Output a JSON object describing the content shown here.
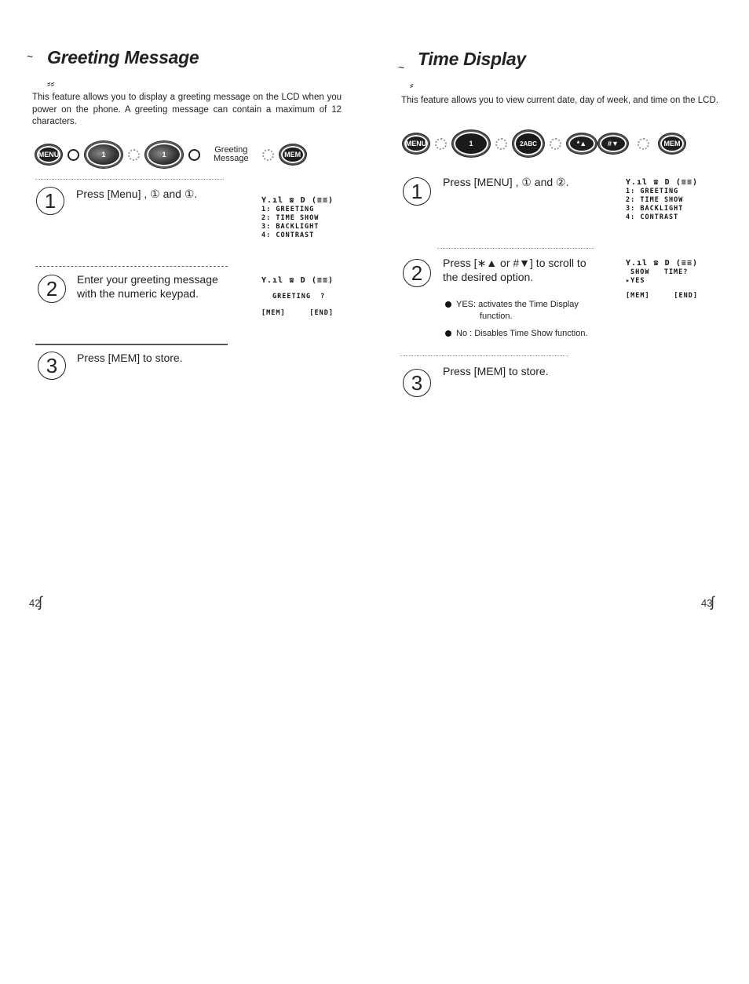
{
  "left_page": {
    "title": "Greeting Message",
    "intro": "This feature allows you to display a greeting message on the LCD when you power on the phone. A greeting message can contain a maximum of 12 characters.",
    "key_sequence": [
      {
        "type": "key",
        "label": "MENU",
        "icon": "menu-key-icon"
      },
      {
        "type": "arrow"
      },
      {
        "type": "key",
        "label": "1",
        "icon": "one-key-icon"
      },
      {
        "type": "arrow"
      },
      {
        "type": "key",
        "label": "1",
        "icon": "one-key-icon"
      },
      {
        "type": "arrow"
      },
      {
        "type": "label",
        "label": "Greeting Message"
      },
      {
        "type": "arrow"
      },
      {
        "type": "key",
        "label": "MEM",
        "icon": "mem-key-icon"
      }
    ],
    "key_labels": {
      "menu": "MENU",
      "one": "1",
      "mem": "MEM",
      "greeting_line1": "Greeting",
      "greeting_line2": "Message"
    },
    "steps": [
      {
        "number": "1",
        "text": "Press [Menu] , ① and ①."
      },
      {
        "number": "2",
        "text": "Enter your greeting message with the numeric keypad."
      },
      {
        "number": "3",
        "text": "Press [MEM] to store."
      }
    ],
    "lcd1": {
      "icons": {
        "signal": "signal-icon",
        "phone": "phone-icon",
        "d": "D",
        "battery": "battery-icon"
      },
      "lines": [
        "1: GREETING",
        "2: TIME SHOW",
        "3: BACKLIGHT",
        "4: CONTRAST"
      ]
    },
    "lcd2": {
      "line": "GREETING  ?",
      "soft_left": "[MEM]",
      "soft_right": "[END]"
    },
    "page_number": "42"
  },
  "right_page": {
    "title": "Time Display",
    "intro": "This feature allows you to view current date, day of week, and time on the LCD.",
    "key_labels": {
      "menu": "MENU",
      "one": "1",
      "two": "2ABC",
      "star": "*▲",
      "hash": "#▼",
      "mem": "MEM"
    },
    "steps": [
      {
        "number": "1",
        "text": "Press [MENU] , ① and ②."
      },
      {
        "number": "2",
        "text": "Press [∗▲ or #▼] to scroll to the desired option."
      },
      {
        "number": "3",
        "text": "Press [MEM] to store."
      }
    ],
    "bullets": [
      {
        "label": "YES: activates the Time Display",
        "cont": "function."
      },
      {
        "label": "No : Disables Time Show function.",
        "cont": ""
      }
    ],
    "lcd1": {
      "lines": [
        "1: GREETING",
        "2: TIME SHOW",
        "3: BACKLIGHT",
        "4: CONTRAST"
      ]
    },
    "lcd2": {
      "line1": "SHOW   TIME?",
      "line2": "▸YES",
      "soft_left": "[MEM]",
      "soft_right": "[END]"
    },
    "page_number": "43"
  },
  "lcd_icons": {
    "signal": "Y.ıl",
    "phone": "☎",
    "d": "D",
    "battery": "(≡≡)"
  }
}
